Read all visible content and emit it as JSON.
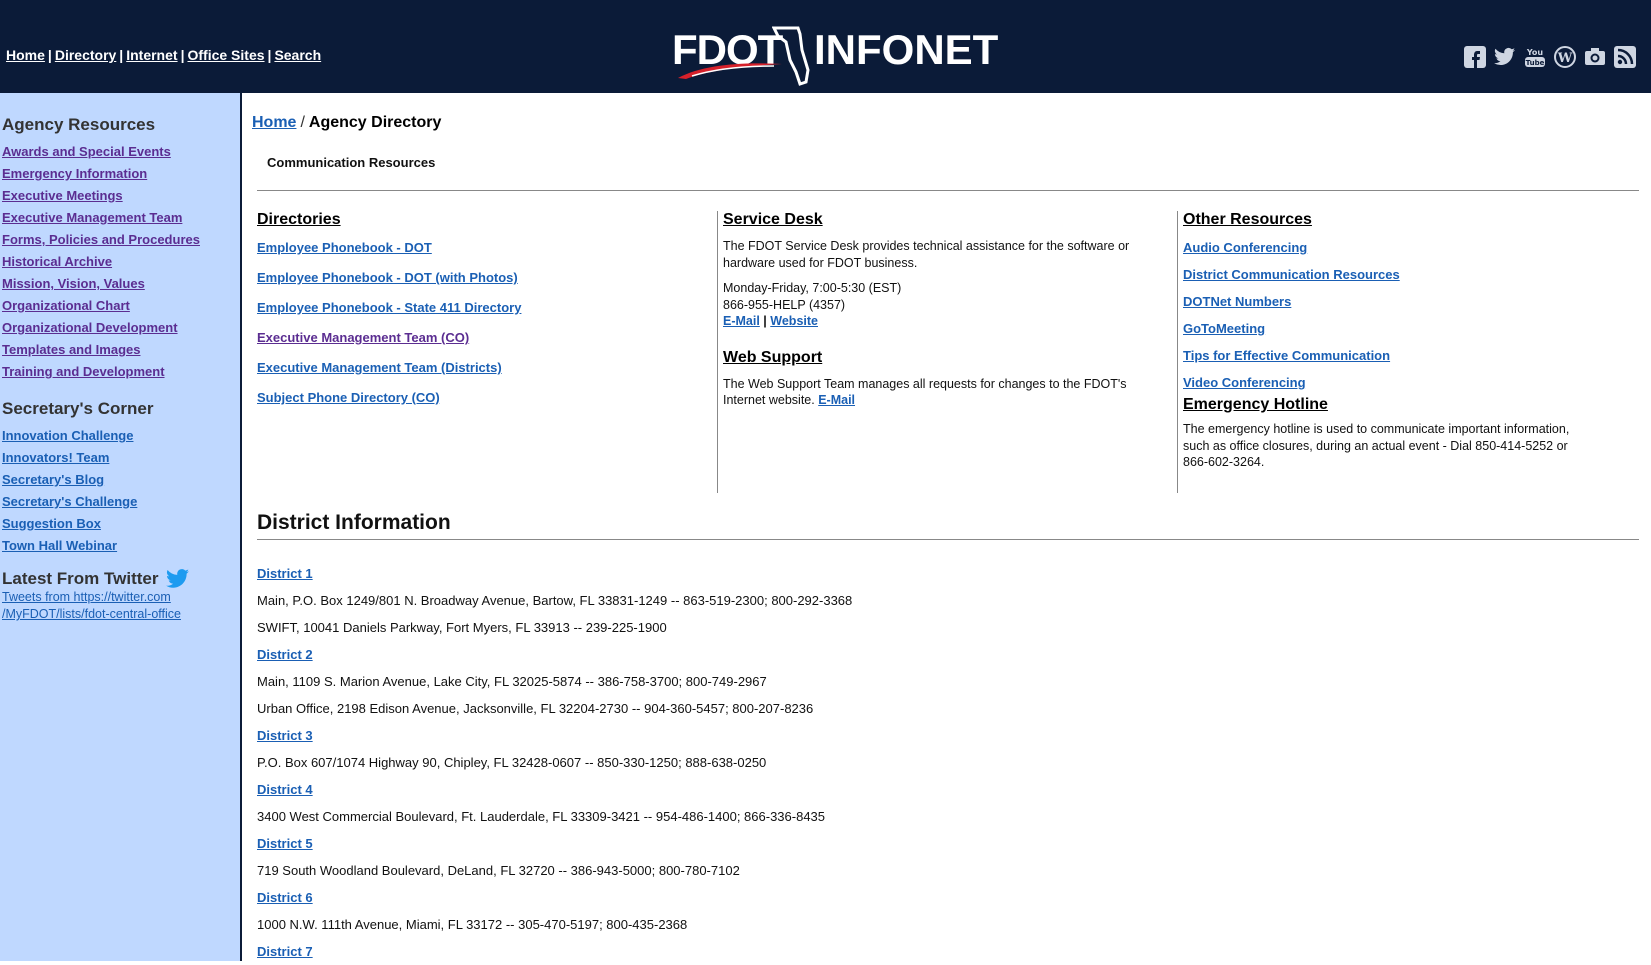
{
  "header": {
    "nav": [
      "Home",
      "Directory",
      "Internet",
      "Office Sites",
      "Search"
    ],
    "logo_left": "FDOT",
    "logo_right": "INFONET",
    "social": [
      "facebook-icon",
      "twitter-icon",
      "youtube-icon",
      "wordpress-icon",
      "camera-icon",
      "rss-icon"
    ]
  },
  "sidebar": {
    "agency_title": "Agency Resources",
    "agency_links": [
      "Awards and Special Events",
      "Emergency Information",
      "Executive Meetings",
      "Executive Management Team",
      "Forms, Policies and Procedures",
      "Historical Archive",
      "Mission, Vision, Values",
      "Organizational Chart",
      "Organizational Development",
      "Templates and Images",
      "Training and Development"
    ],
    "secretary_title": "Secretary's Corner",
    "secretary_links": [
      "Innovation Challenge",
      "Innovators! Team",
      "Secretary's Blog",
      "Secretary's Challenge",
      "Suggestion Box",
      "Town Hall Webinar"
    ],
    "twitter_title": "Latest From Twitter",
    "tweets_line1": "Tweets from https://twitter.com",
    "tweets_line2": "/MyFDOT/lists/fdot-central-office"
  },
  "breadcrumb": {
    "home": "Home",
    "separator": "/",
    "current": "Agency Directory"
  },
  "subheading": "Communication Resources",
  "directories": {
    "title": "Directories",
    "links": [
      "Employee Phonebook - DOT",
      "Employee Phonebook - DOT (with Photos)",
      "Employee Phonebook - State 411 Directory",
      "Executive Management Team (CO)",
      "Executive Management Team (Districts)",
      "Subject Phone Directory (CO)"
    ]
  },
  "service_desk": {
    "title": "Service Desk",
    "description": "The FDOT Service Desk provides technical assistance for the software or hardware used for FDOT business.",
    "hours": "Monday-Friday, 7:00-5:30 (EST)",
    "phone": "866-955-HELP (4357)",
    "email_label": "E-Mail",
    "divider": "|",
    "website_label": "Website"
  },
  "web_support": {
    "title": "Web Support",
    "description": "The Web Support Team manages all requests for changes to the FDOT's Internet website.",
    "email_label": "E-Mail"
  },
  "other_resources": {
    "title": "Other Resources",
    "links": [
      "Audio Conferencing",
      "District Communication Resources",
      "DOTNet Numbers",
      "GoToMeeting",
      "Tips for Effective Communication",
      "Video Conferencing"
    ]
  },
  "emergency": {
    "title": "Emergency Hotline",
    "description": "The emergency hotline is used to communicate important information, such as office closures, during an actual event - Dial 850-414-5252 or 866-602-3264."
  },
  "district_info": {
    "title": "District Information",
    "items": [
      {
        "type": "link",
        "text": "District 1"
      },
      {
        "type": "addr",
        "text": "Main, P.O. Box 1249/801 N. Broadway Avenue, Bartow, FL 33831-1249 -- 863-519-2300; 800-292-3368"
      },
      {
        "type": "addr",
        "text": "SWIFT, 10041 Daniels Parkway, Fort Myers, FL 33913 -- 239-225-1900"
      },
      {
        "type": "link",
        "text": "District 2"
      },
      {
        "type": "addr",
        "text": "Main, 1109 S. Marion Avenue, Lake City, FL 32025-5874 -- 386-758-3700; 800-749-2967"
      },
      {
        "type": "addr",
        "text": "Urban Office, 2198 Edison Avenue, Jacksonville, FL 32204-2730 -- 904-360-5457; 800-207-8236"
      },
      {
        "type": "link",
        "text": "District 3"
      },
      {
        "type": "addr",
        "text": "P.O. Box 607/1074 Highway 90, Chipley, FL 32428-0607 -- 850-330-1250; 888-638-0250"
      },
      {
        "type": "link",
        "text": "District 4"
      },
      {
        "type": "addr",
        "text": "3400 West Commercial Boulevard, Ft. Lauderdale, FL 33309-3421 -- 954-486-1400; 866-336-8435"
      },
      {
        "type": "link",
        "text": "District 5"
      },
      {
        "type": "addr",
        "text": "719 South Woodland Boulevard, DeLand, FL 32720 -- 386-943-5000; 800-780-7102"
      },
      {
        "type": "link",
        "text": "District 6"
      },
      {
        "type": "addr",
        "text": "1000 N.W. 111th Avenue, Miami, FL 33172 -- 305-470-5197; 800-435-2368"
      },
      {
        "type": "link",
        "text": "District 7"
      }
    ]
  },
  "colors": {
    "header_bg": "#0b1b38",
    "sidebar_bg": "#bfd8ff",
    "link": "#1a5fb4",
    "visited": "#5b2d91",
    "logo_red": "#d6202a"
  }
}
